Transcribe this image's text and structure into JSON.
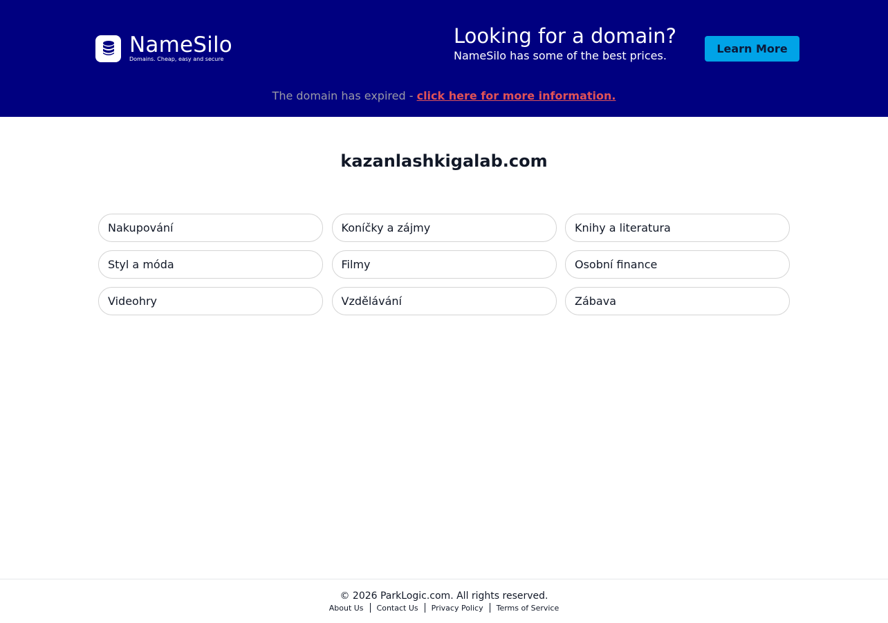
{
  "header": {
    "logo": {
      "name": "NameSilo",
      "tagline": "Domains. Cheap, easy and secure",
      "icon": "database-icon"
    },
    "promo": {
      "title": "Looking for a domain?",
      "subtitle": "NameSilo has some of the best prices."
    },
    "learn_more_label": "Learn More",
    "expired": {
      "text": "The domain has expired - ",
      "link_label": "click here for more information."
    },
    "colors": {
      "background": "#000080",
      "button": "#00a3e7",
      "link": "#e05257"
    }
  },
  "main": {
    "domain": "kazanlashkigalab.com",
    "links": [
      {
        "label": "Nakupování"
      },
      {
        "label": "Koníčky a zájmy"
      },
      {
        "label": "Knihy a literatura"
      },
      {
        "label": "Styl a móda"
      },
      {
        "label": "Filmy"
      },
      {
        "label": "Osobní finance"
      },
      {
        "label": "Videohry"
      },
      {
        "label": "Vzdělávání"
      },
      {
        "label": "Zábava"
      }
    ]
  },
  "footer": {
    "copyright": "© 2026 ParkLogic.com. All rights reserved.",
    "links": [
      {
        "label": "About Us"
      },
      {
        "label": "Contact Us"
      },
      {
        "label": "Privacy Policy"
      },
      {
        "label": "Terms of Service"
      }
    ]
  }
}
